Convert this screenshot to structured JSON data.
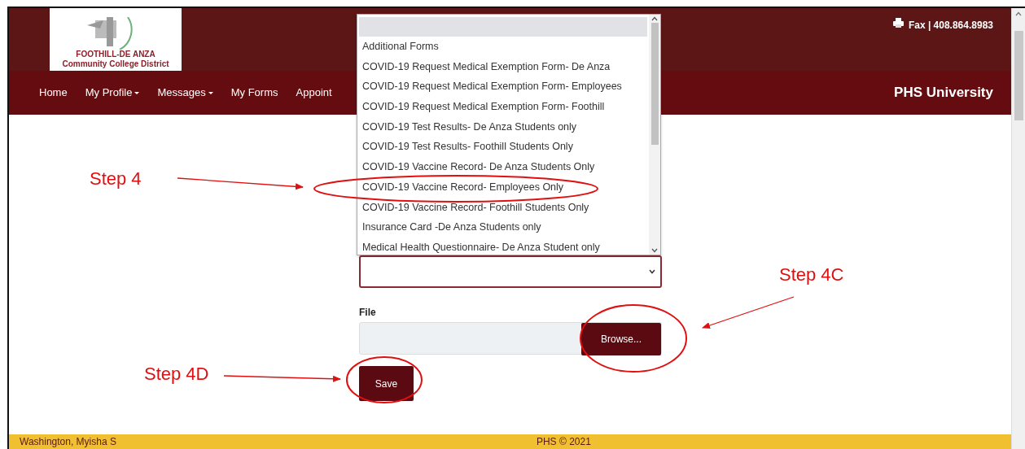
{
  "header": {
    "logo_lines": [
      "FOOTHILL-DE ANZA",
      "Community College District"
    ],
    "fax": "Fax | 408.864.8983"
  },
  "nav": {
    "items": [
      {
        "label": "Home",
        "dropdown": false
      },
      {
        "label": "My Profile",
        "dropdown": true
      },
      {
        "label": "Messages",
        "dropdown": true
      },
      {
        "label": "My Forms",
        "dropdown": false
      },
      {
        "label": "Appoint",
        "dropdown": false
      }
    ],
    "brand": "PHS University"
  },
  "form_list": {
    "options": [
      "Additional Forms",
      "COVID-19 Request Medical Exemption Form- De Anza",
      "COVID-19 Request Medical Exemption Form- Employees",
      "COVID-19 Request Medical Exemption Form- Foothill",
      "COVID-19 Test Results- De Anza Students only",
      "COVID-19 Test Results- Foothill Students Only",
      "COVID-19 Vaccine Record- De Anza Students Only",
      "COVID-19 Vaccine Record- Employees Only",
      "COVID-19 Vaccine Record- Foothill Students Only",
      "Insurance Card -De Anza Students only",
      "Medical Health Questionnaire- De Anza Student only"
    ]
  },
  "form": {
    "file_label": "File",
    "browse": "Browse...",
    "save": "Save"
  },
  "annotations": [
    {
      "label": "Step 4"
    },
    {
      "label": "Step 4C"
    },
    {
      "label": "Step 4D"
    }
  ],
  "footer": {
    "user": "Washington, Myisha S",
    "copyright": "PHS © 2021"
  }
}
